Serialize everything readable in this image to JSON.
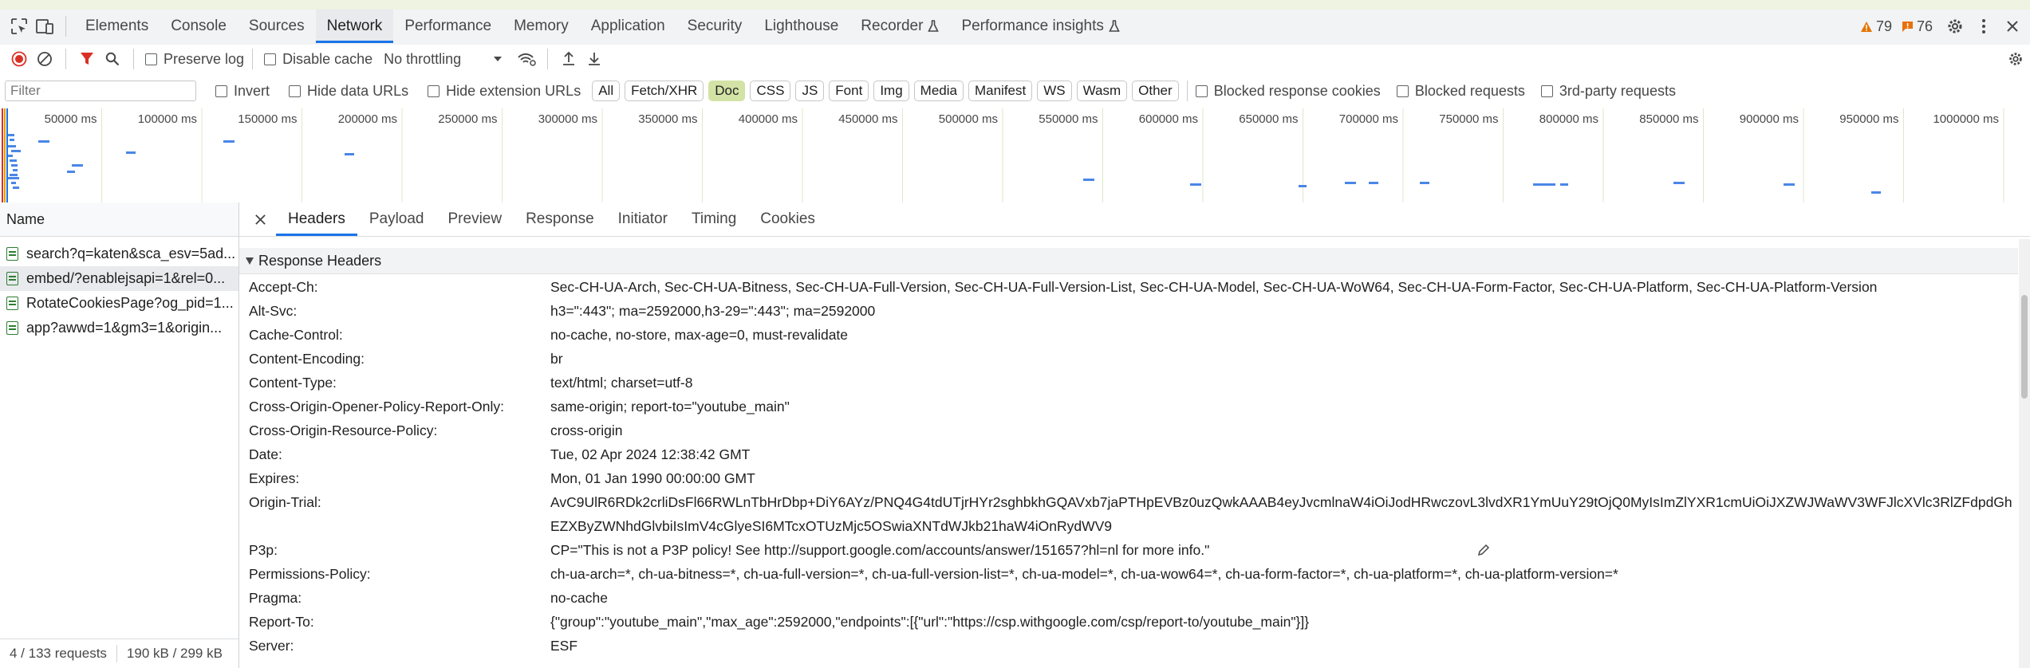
{
  "top_tabs": [
    "Elements",
    "Console",
    "Sources",
    "Network",
    "Performance",
    "Memory",
    "Application",
    "Security",
    "Lighthouse",
    "Recorder",
    "Performance insights"
  ],
  "active_top_tab": "Network",
  "issues": {
    "warnings": "79",
    "errors": "76"
  },
  "toolbar": {
    "preserve_log": "Preserve log",
    "disable_cache": "Disable cache",
    "throttling": "No throttling"
  },
  "filter_bar": {
    "placeholder": "Filter",
    "invert": "Invert",
    "hide_data_urls": "Hide data URLs",
    "hide_extension_urls": "Hide extension URLs",
    "types": [
      "All",
      "Fetch/XHR",
      "Doc",
      "CSS",
      "JS",
      "Font",
      "Img",
      "Media",
      "Manifest",
      "WS",
      "Wasm",
      "Other"
    ],
    "active_type": "Doc",
    "blocked_response_cookies": "Blocked response cookies",
    "blocked_requests": "Blocked requests",
    "third_party": "3rd-party requests"
  },
  "timeline": {
    "ticks": [
      "50000 ms",
      "100000 ms",
      "150000 ms",
      "200000 ms",
      "250000 ms",
      "300000 ms",
      "350000 ms",
      "400000 ms",
      "450000 ms",
      "500000 ms",
      "550000 ms",
      "600000 ms",
      "650000 ms",
      "700000 ms",
      "750000 ms",
      "800000 ms",
      "850000 ms",
      "900000 ms",
      "950000 ms",
      "1000000 ms"
    ]
  },
  "requests_panel": {
    "name_header": "Name",
    "requests": [
      "search?q=katen&sca_esv=5ad...",
      "embed/?enablejsapi=1&rel=0...",
      "RotateCookiesPage?og_pid=1...",
      "app?awwd=1&gm3=1&origin..."
    ],
    "selected_index": 1,
    "summary_requests": "4 / 133 requests",
    "summary_size": "190 kB / 299 kB"
  },
  "detail_tabs": [
    "Headers",
    "Payload",
    "Preview",
    "Response",
    "Initiator",
    "Timing",
    "Cookies"
  ],
  "active_detail_tab": "Headers",
  "section_title": "Response Headers",
  "headers": [
    {
      "k": "Accept-Ch:",
      "v": "Sec-CH-UA-Arch, Sec-CH-UA-Bitness, Sec-CH-UA-Full-Version, Sec-CH-UA-Full-Version-List, Sec-CH-UA-Model, Sec-CH-UA-WoW64, Sec-CH-UA-Form-Factor, Sec-CH-UA-Platform, Sec-CH-UA-Platform-Version"
    },
    {
      "k": "Alt-Svc:",
      "v": "h3=\":443\"; ma=2592000,h3-29=\":443\"; ma=2592000"
    },
    {
      "k": "Cache-Control:",
      "v": "no-cache, no-store, max-age=0, must-revalidate"
    },
    {
      "k": "Content-Encoding:",
      "v": "br"
    },
    {
      "k": "Content-Type:",
      "v": "text/html; charset=utf-8"
    },
    {
      "k": "Cross-Origin-Opener-Policy-Report-Only:",
      "v": "same-origin; report-to=\"youtube_main\""
    },
    {
      "k": "Cross-Origin-Resource-Policy:",
      "v": "cross-origin"
    },
    {
      "k": "Date:",
      "v": "Tue, 02 Apr 2024 12:38:42 GMT"
    },
    {
      "k": "Expires:",
      "v": "Mon, 01 Jan 1990 00:00:00 GMT"
    },
    {
      "k": "Origin-Trial:",
      "v": "AvC9UlR6RDk2crliDsFl66RWLnTbHrDbp+DiY6AYz/PNQ4G4tdUTjrHYr2sghbkhGQAVxb7jaPTHpEVBz0uzQwkAAAB4eyJvcmlnaW4iOiJodHRwczovL3lvdXR1YmUuY29tOjQ0MyIsImZlYXR1cmUiOiJXZWJWaWV3WFJlcXVlc3RlZFdpdGh",
      "v2": "EZXByZWNhdGlvbiIsImV4cGlyeSI6MTcxOTUzMjc5OSwiaXNTdWJkb21haW4iOnRydWV9"
    },
    {
      "k": "P3p:",
      "v": "CP=\"This is not a P3P policy! See http://support.google.com/accounts/answer/151657?hl=nl for more info.\""
    },
    {
      "k": "Permissions-Policy:",
      "v": "ch-ua-arch=*, ch-ua-bitness=*, ch-ua-full-version=*, ch-ua-full-version-list=*, ch-ua-model=*, ch-ua-wow64=*, ch-ua-form-factor=*, ch-ua-platform=*, ch-ua-platform-version=*"
    },
    {
      "k": "Pragma:",
      "v": "no-cache"
    },
    {
      "k": "Report-To:",
      "v": "{\"group\":\"youtube_main\",\"max_age\":2592000,\"endpoints\":[{\"url\":\"https://csp.withgoogle.com/csp/report-to/youtube_main\"}]}"
    },
    {
      "k": "Server:",
      "v": "ESF"
    }
  ],
  "colors": {
    "accent": "#1a73e8",
    "active_chip": "#d3e3a6",
    "record": "#d93025",
    "waterfall_bar": "#4a86e8"
  }
}
